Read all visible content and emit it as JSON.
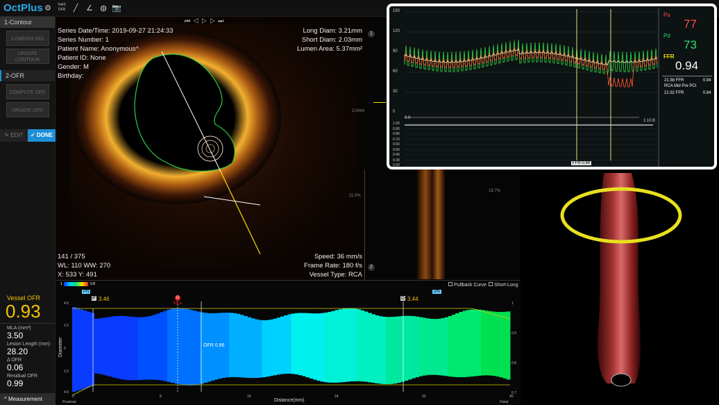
{
  "app": {
    "name": "OctPlus"
  },
  "toolbar": {
    "ofr_label": "%AS\nOFR"
  },
  "left_panel": {
    "section1": {
      "title": "1-Contour",
      "confirm_roi": "CONFIRM ROI",
      "update_contour": "UPDATE CONTOUR"
    },
    "section2": {
      "title": "2-OFR",
      "compute_ofr": "COMPUTE OFR",
      "update_ofr": "UPDATE OFR"
    },
    "edit_label": "EDIT",
    "done_label": "DONE",
    "vessel_ofr_label": "Vessel OFR",
    "vessel_ofr_value": "0.93",
    "mla_label": "MLA (mm²)",
    "mla_value": "3.50",
    "lesion_length_label": "Lesion Length (mm)",
    "lesion_length_value": "28.20",
    "delta_ofr_label": "Δ OFR",
    "delta_ofr_value": "0.06",
    "residual_ofr_label": "Residual OFR",
    "residual_ofr_value": "0.99",
    "measurement_label": "Measurement"
  },
  "oct": {
    "series_datetime": "Series Date/Time: 2019-09-27 21:24:33",
    "series_number": "Series Number: 1",
    "patient_name": "Patient Name: Anonymous^",
    "patient_id": "Patient ID: None",
    "gender": "Gender: M",
    "birthday": "Birthday:",
    "long_diam": "Long Diam: 3.21mm",
    "short_diam": "Short Diam: 2.03mm",
    "lumen_area": "Lumen Area: 5.37mm²",
    "frame_index": "141 / 375",
    "wl_ww": "WL: 110  WW: 270",
    "xy": "X: 533  Y: 491",
    "speed": "Speed: 36 mm/s",
    "frame_rate": "Frame Rate: 180 f/s",
    "vessel_type": "Vessel Type: RCA"
  },
  "mid_strip": {
    "marker1": "1",
    "marker2": "2",
    "scale_top": "2.0mm",
    "pct_left": "11.0%",
    "pct_right": "18.7%"
  },
  "lower_chart": {
    "pullback_label": "Pullback Curve",
    "shortlong_label": "Short-Long",
    "colorbar_min": "1",
    "colorbar_max": "0.8",
    "p_marker": "P",
    "p_value": "3.46",
    "o_marker": "O",
    "mla_marker": "MLA",
    "d_marker": "D",
    "d_value": "3.44",
    "pn_tag": "PN",
    "dn_tag": "DN",
    "ofr_label": "OFR 0.96",
    "y_label": "Diameter",
    "x_label": "Distance(mm)",
    "proximal": "Proximal",
    "distal": "Distal",
    "y_ticks": [
      "4.5",
      "2.2",
      "0",
      "2.2",
      "4.5"
    ],
    "x_ticks": [
      "0",
      "8",
      "16",
      "24",
      "32",
      "40"
    ],
    "right_ticks": [
      "1",
      "0.9",
      "0.8",
      "0.7"
    ]
  },
  "inset": {
    "y_ticks": [
      "150",
      "120",
      "90",
      "60",
      "30",
      "0"
    ],
    "lower_ticks": [
      "1.00",
      "0.90",
      "0.80",
      "0.70",
      "0.60",
      "0.50",
      "0.40",
      "0.30",
      "0.20"
    ],
    "top_value": "0.0",
    "ratio_label": "1:10.8",
    "ffr_tag": "FFR 0.94",
    "pa_label": "Pa",
    "pa_value": "77",
    "pd_label": "Pd",
    "pd_value": "73",
    "ffr_label": "FFR",
    "ffr_value": "0.94",
    "hist1_label": "21:38 FFR",
    "hist1_value": "0.94",
    "hist1_sub": "RCA Mid Pre PCI",
    "hist2_label": "21:32 FFR",
    "hist2_value": "0.84"
  }
}
